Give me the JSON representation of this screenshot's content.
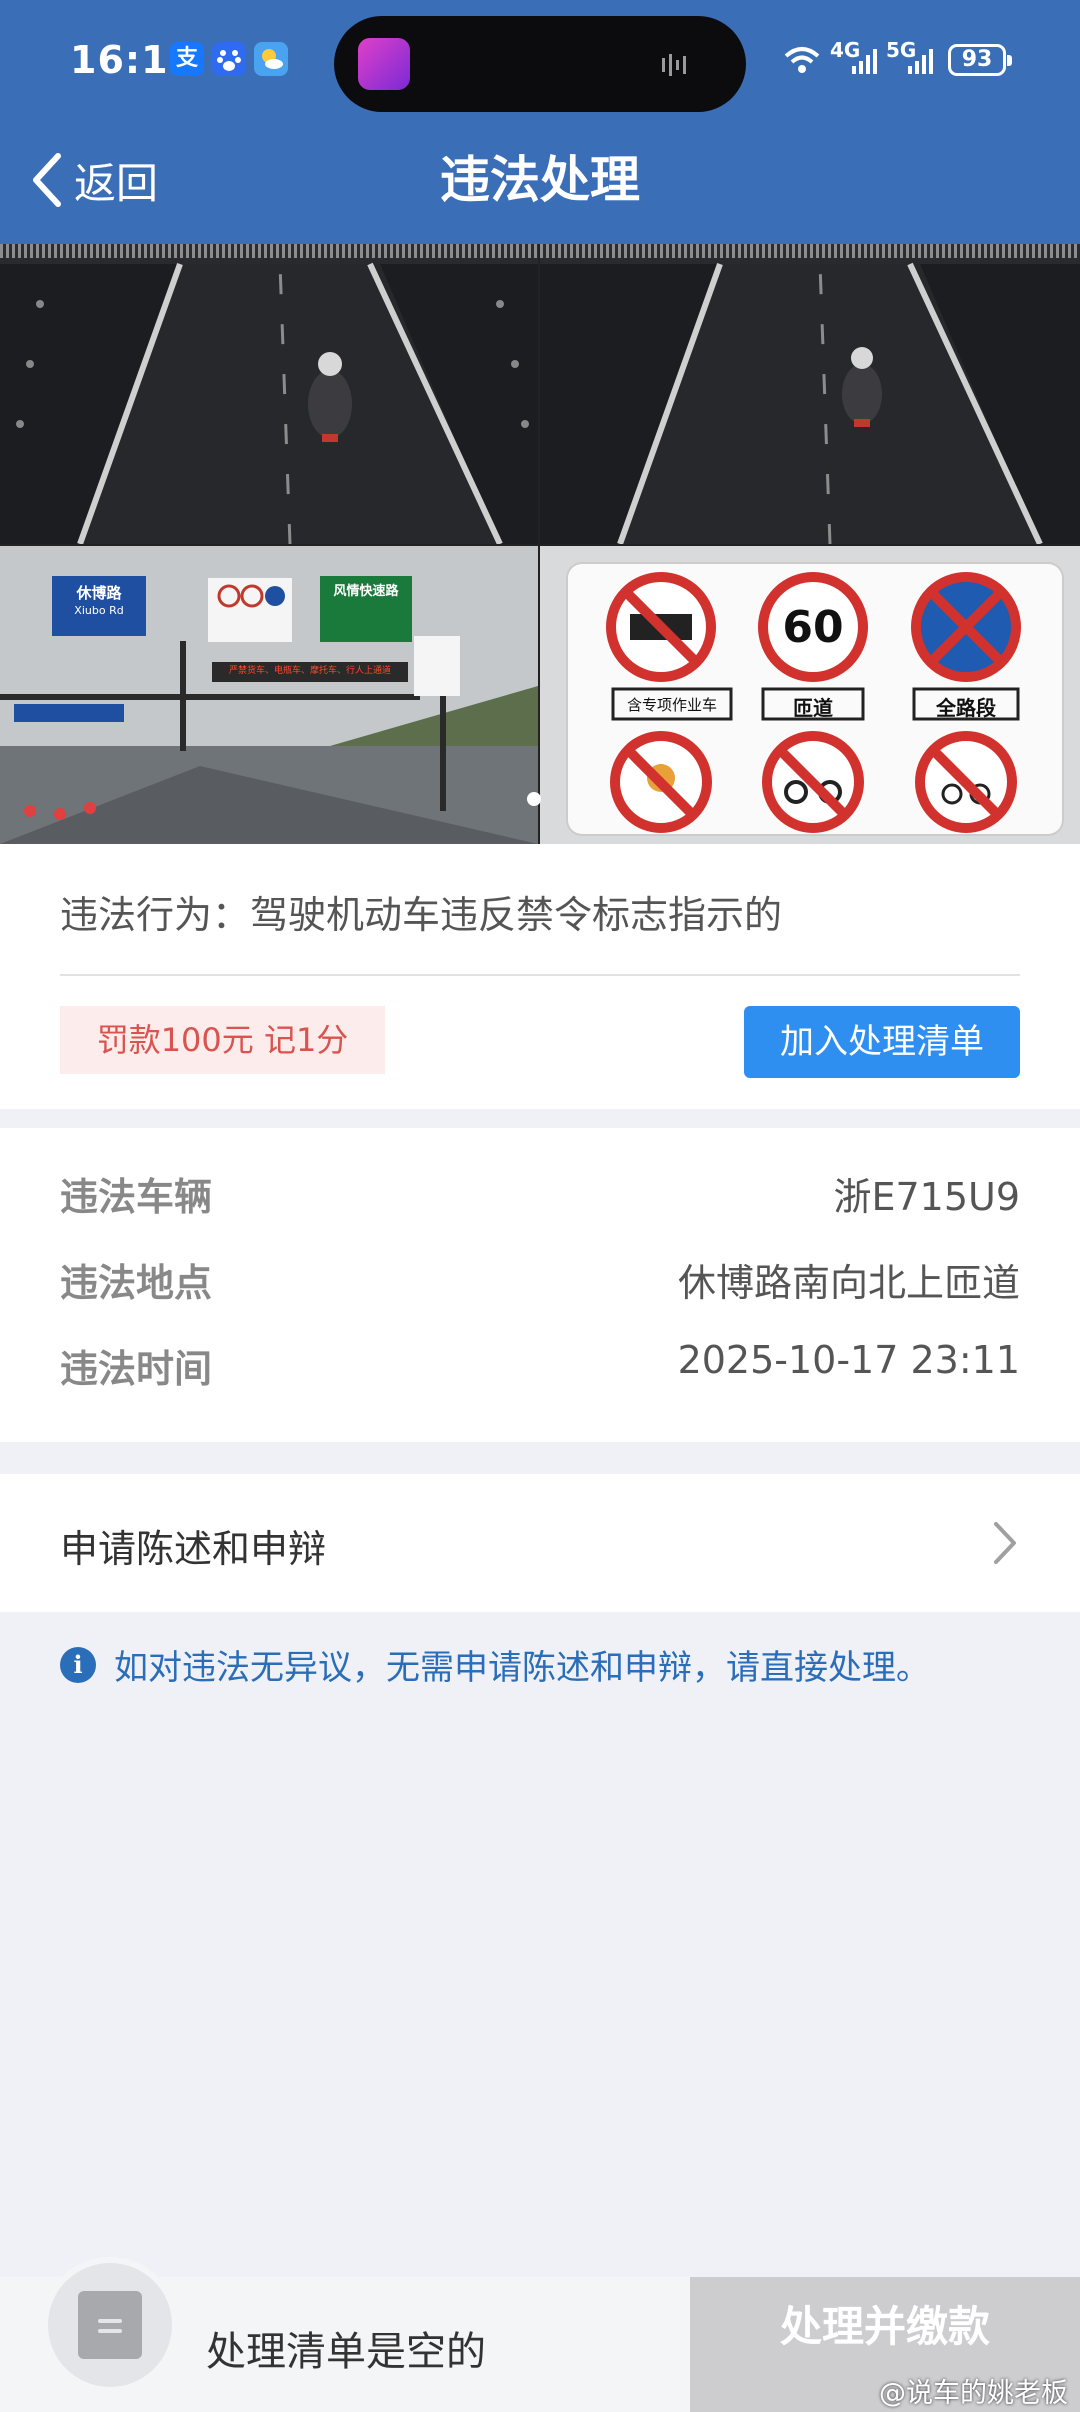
{
  "status_bar": {
    "time": "16:11",
    "app_icons": [
      "alipay-icon",
      "baidu-icon",
      "weather-icon"
    ],
    "alipay_glyph": "支",
    "network_1": "4G",
    "network_2": "5G",
    "battery": "93"
  },
  "header": {
    "back_label": "返回",
    "title": "违法处理"
  },
  "photos": {
    "count": 4,
    "active_index": 0,
    "sign_texts": {
      "road_sign": "休博路",
      "road_sign_en": "Xiubo Rd",
      "limit": "60",
      "direction_sign": "风情快速路",
      "led_text": "严禁货车、电瓶车、摩托车、行人上通道",
      "card_label_1": "含专项作业车",
      "card_label_2": "匝道",
      "card_label_3": "全路段"
    }
  },
  "violation": {
    "behavior_label": "违法行为：",
    "behavior_value": "驾驶机动车违反禁令标志指示的",
    "penalty": "罚款100元 记1分",
    "add_button": "加入处理清单"
  },
  "details": [
    {
      "key": "违法车辆",
      "value": "浙E715U9"
    },
    {
      "key": "违法地点",
      "value": "休博路南向北上匝道"
    },
    {
      "key": "违法时间",
      "value": "2025-10-17 23:11"
    }
  ],
  "appeal": {
    "label": "申请陈述和申辩"
  },
  "notice": {
    "icon_glyph": "i",
    "text": "如对违法无异议，无需申请陈述和申辩，请直接处理。"
  },
  "bottom": {
    "cart_text": "处理清单是空的",
    "pay_button": "处理并缴款"
  },
  "watermark": "@说车的姚老板",
  "colors": {
    "header_bg": "#3a6fb8",
    "primary_button": "#2f8ff0",
    "penalty_text": "#d9534f",
    "penalty_bg": "#fdecec",
    "notice_text": "#2a6db8",
    "disabled_button": "#cdcdd0"
  }
}
